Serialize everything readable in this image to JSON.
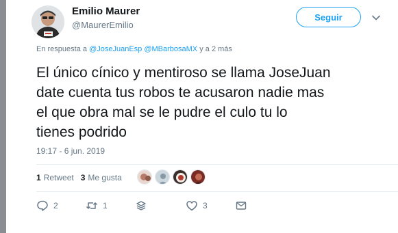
{
  "user": {
    "name": "Emilio Maurer",
    "handle": "@MaurerEmilio"
  },
  "follow_button": {
    "label": "Seguir"
  },
  "reply_to": {
    "prefix": "En respuesta a",
    "mention1": "@JoseJuanEsp",
    "mention2": "@MBarbosaMX",
    "suffix": "y a 2 más"
  },
  "tweet": {
    "lines": [
      "El único cínico y mentiroso se llama JoseJuan",
      "date cuenta tus robos te acusaron nadie mas",
      "el que obra mal se le pudre el culo tu lo",
      "tienes podrido"
    ],
    "timestamp": "19:17 - 6 jun. 2019"
  },
  "stats": {
    "retweets": {
      "count": "1",
      "label": "Retweet"
    },
    "likes": {
      "count": "3",
      "label": "Me gusta"
    }
  },
  "actions": {
    "reply": {
      "icon": "reply-icon",
      "count": "2"
    },
    "retweet": {
      "icon": "retweet-icon",
      "count": "1"
    },
    "stack": {
      "icon": "stack-icon",
      "count": ""
    },
    "like": {
      "icon": "heart-icon",
      "count": "3"
    },
    "message": {
      "icon": "envelope-icon",
      "count": ""
    }
  },
  "colors": {
    "accent": "#1da1f2",
    "secondary_text": "#657786",
    "primary_text": "#14171a",
    "divider": "#e6ecf0"
  }
}
